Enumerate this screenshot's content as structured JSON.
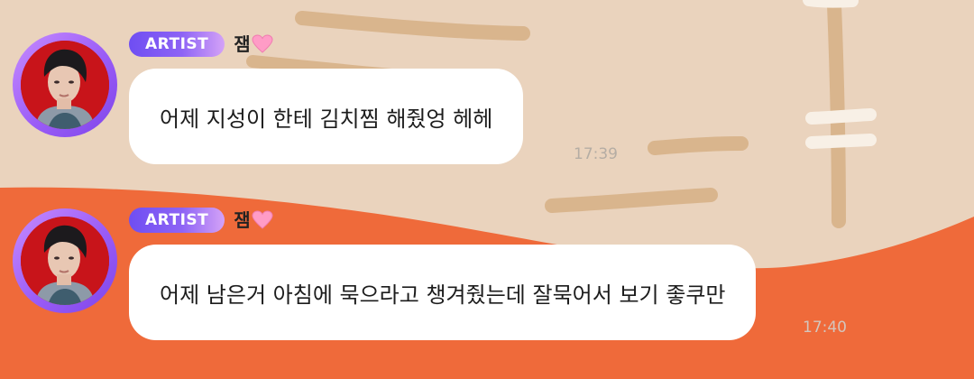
{
  "messages": [
    {
      "badge": "ARTIST",
      "name": "잼",
      "text": "어제 지성이 한테 김치찜 해줬엉 헤헤",
      "time": "17:39"
    },
    {
      "badge": "ARTIST",
      "name": "잼",
      "text": "어제 남은거 아침에 묵으라고 챙겨줬는데 잘묵어서 보기 좋쿠만",
      "time": "17:40"
    }
  ],
  "icons": {
    "heart": "pink-heart-icon"
  },
  "colors": {
    "background_beige": "#ead3bd",
    "background_orange": "#ef6a3a",
    "badge_start": "#6f4ef2",
    "badge_end": "#d4a2f7",
    "bubble": "#ffffff",
    "heart": "#ff8fbf",
    "avatar_ring": "#9a5cf6"
  }
}
